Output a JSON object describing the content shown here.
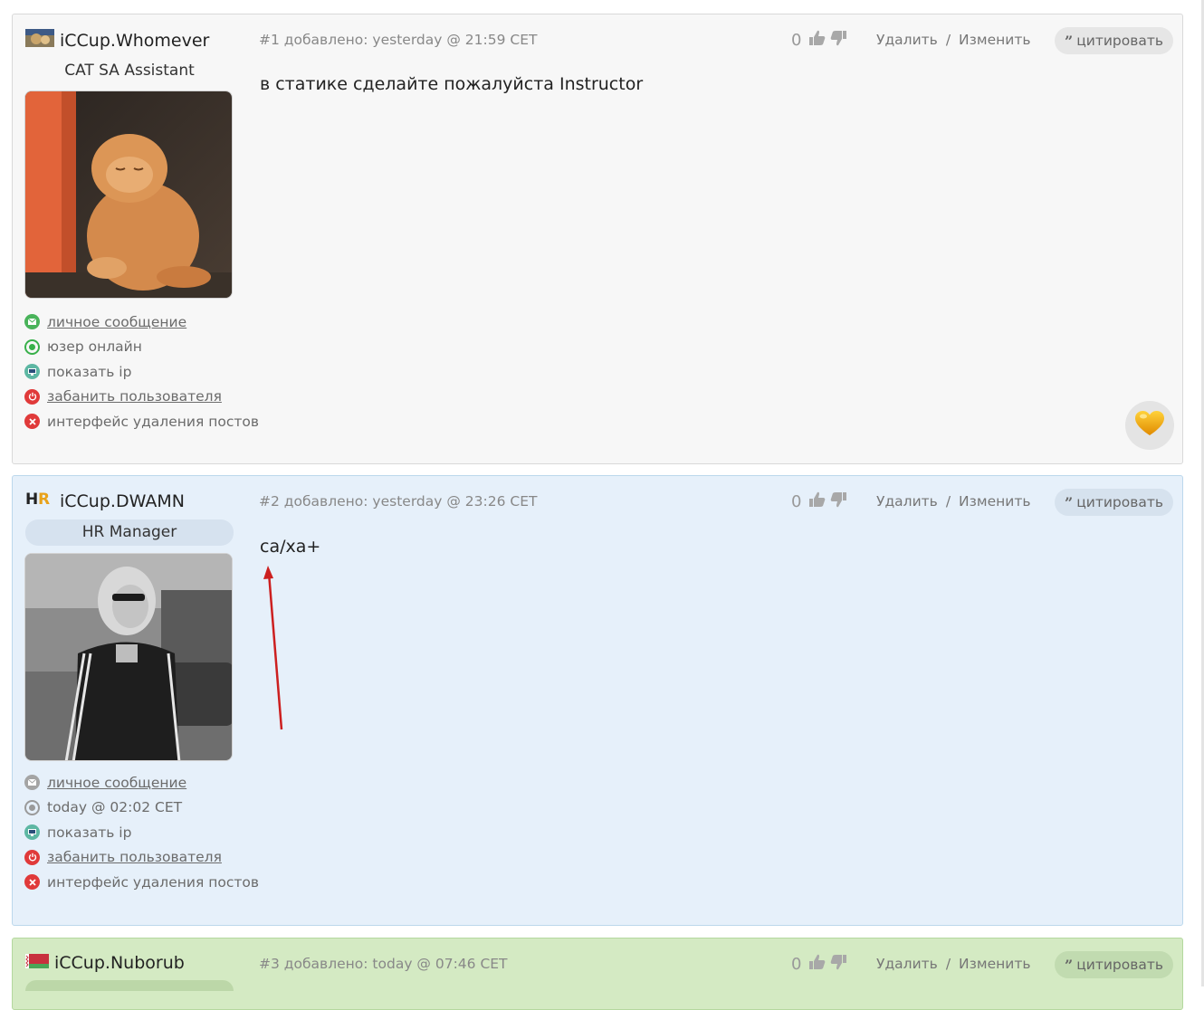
{
  "posts": [
    {
      "user": "iCCup.Whomever",
      "rank": "CAT SA Assistant",
      "number": "#1",
      "added_label": "добавлено:",
      "time": "yesterday @ 21:59 CET",
      "votes": "0",
      "delete_label": "Удалить",
      "divider": "/",
      "edit_label": "Изменить",
      "quote_label": "цитировать",
      "content": "в статике сделайте пожалуйста Instructor",
      "links": {
        "pm": "личное сообщение",
        "status": "юзер онлайн",
        "ip": "показать ip",
        "ban": "забанить пользователя",
        "delete_ui": "интерфейс удаления постов"
      },
      "avatar_icon": "orange-cat-avatar"
    },
    {
      "user": "iCCup.DWAMN",
      "rank": "HR Manager",
      "number": "#2",
      "added_label": "добавлено:",
      "time": "yesterday @ 23:26 CET",
      "votes": "0",
      "delete_label": "Удалить",
      "divider": "/",
      "edit_label": "Изменить",
      "quote_label": "цитировать",
      "content": "ca/xa+",
      "links": {
        "pm": "личное сообщение",
        "status": "today @ 02:02 CET",
        "ip": "показать ip",
        "ban": "забанить пользователя",
        "delete_ui": "интерфейс удаления постов"
      },
      "avatar_icon": "woman-sunglasses-avatar",
      "hr_logo": "HR"
    },
    {
      "user": "iCCup.Nuborub",
      "number": "#3",
      "added_label": "добавлено:",
      "time": "today @ 07:46 CET",
      "votes": "0",
      "delete_label": "Удалить",
      "divider": "/",
      "edit_label": "Изменить",
      "quote_label": "цитировать"
    }
  ],
  "colors": {
    "post1_bg": "#f7f7f7",
    "post2_bg": "#e6f0fa",
    "post3_bg": "#d4eac3",
    "online": "#38b04a",
    "ban": "#e03a3a",
    "annotation_arrow": "#cc1f1f"
  }
}
